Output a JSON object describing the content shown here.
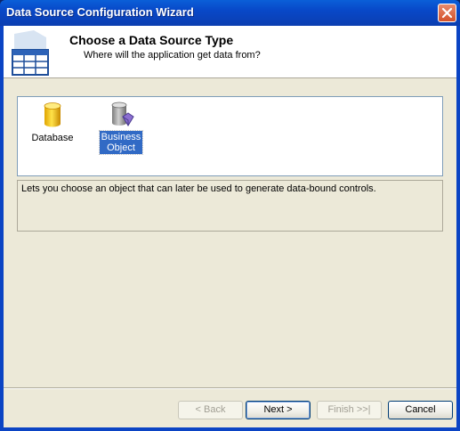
{
  "window": {
    "title": "Data Source Configuration Wizard"
  },
  "header": {
    "title": "Choose a Data Source Type",
    "subtitle": "Where will the application get data from?"
  },
  "types": [
    {
      "label_line1": "Database",
      "label_line2": "",
      "selected": false,
      "icon": "database-icon"
    },
    {
      "label_line1": "Business",
      "label_line2": "Object",
      "selected": true,
      "icon": "business-object-icon"
    }
  ],
  "description": "Lets you choose an object that can later be used to generate data-bound controls.",
  "buttons": {
    "back": "< Back",
    "next": "Next >",
    "finish": "Finish >>|",
    "cancel": "Cancel"
  },
  "colors": {
    "titlebar": "#0848c8",
    "dialog_bg": "#ece9d8",
    "selection": "#316ac5"
  }
}
